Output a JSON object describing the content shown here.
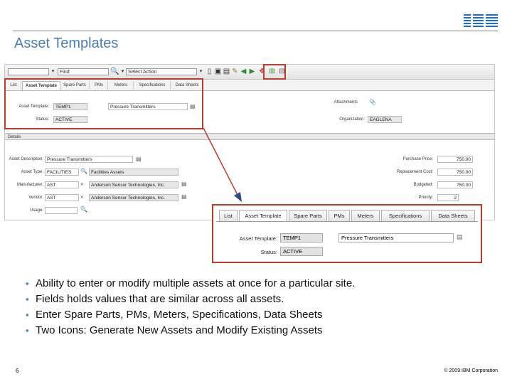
{
  "slide": {
    "title": "Asset Templates",
    "page_number": "6",
    "copyright": "© 2009 IBM Corporation",
    "logo": "IBM"
  },
  "app": {
    "toolbar": {
      "find_value": "",
      "find_label": "Find",
      "select_action": "Select Action"
    },
    "tabs": [
      "List",
      "Asset Template",
      "Spare Parts",
      "PMs",
      "Meters",
      "Specifications",
      "Data Sheets"
    ],
    "header_fields": {
      "asset_template_label": "Asset Template:",
      "asset_template_value": "TEMP1",
      "asset_template_desc": "Pressure Transmitters",
      "status_label": "Status:",
      "status_value": "ACTIVE",
      "attachments_label": "Attachments",
      "organization_label": "Organization:",
      "organization_value": "EAGLENA"
    },
    "details": {
      "section_label": "Details",
      "asset_description_label": "Asset Description:",
      "asset_description_value": "Pressure Transmitters",
      "asset_type_label": "Asset Type:",
      "asset_type_value": "FACILITIES",
      "asset_type_desc": "Facilities Assets",
      "manufacturer_label": "Manufacturer:",
      "manufacturer_value": "AST",
      "manufacturer_desc": "Anderson Sensor Technologies, Inc.",
      "vendor_label": "Vendor:",
      "vendor_value": "AST",
      "vendor_desc": "Anderson Sensor Technologies, Inc.",
      "usage_label": "Usage:",
      "usage_value": "",
      "purchase_price_label": "Purchase Price:",
      "purchase_price_value": "750.00",
      "replacement_cost_label": "Replacement Cost:",
      "replacement_cost_value": "750.00",
      "budgeted_label": "Budgeted:",
      "budgeted_value": "750.00",
      "priority_label": "Priority:",
      "priority_value": "2"
    }
  },
  "zoom": {
    "tabs": [
      "List",
      "Asset Template",
      "Spare Parts",
      "PMs",
      "Meters",
      "Specifications",
      "Data Sheets"
    ],
    "asset_template_label": "Asset Template:",
    "asset_template_value": "TEMP1",
    "asset_template_desc": "Pressure Transmitters",
    "status_label": "Status:",
    "status_value": "ACTIVE"
  },
  "bullets": [
    "Ability to enter or modify multiple assets at once for a particular site.",
    "Fields holds values that are similar across all assets.",
    "Enter Spare Parts, PMs, Meters, Specifications, Data Sheets",
    "Two Icons: Generate New Assets and Modify Existing Assets"
  ],
  "colors": {
    "title": "#4a7ebb",
    "highlight": "#c0392b",
    "ibm_logo": "#1f6fbf"
  }
}
